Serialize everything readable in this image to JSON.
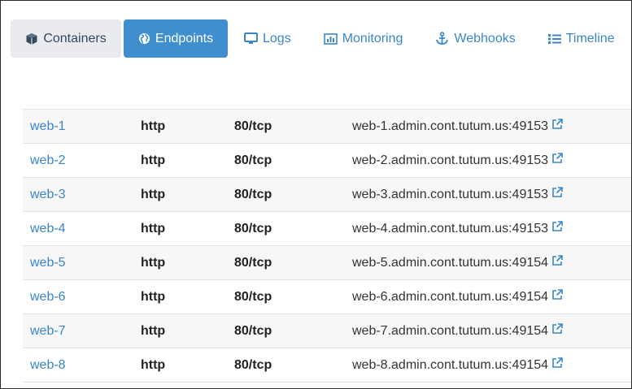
{
  "tabs": [
    {
      "label": "Containers",
      "icon": "cube-icon"
    },
    {
      "label": "Endpoints",
      "icon": "globe-icon"
    },
    {
      "label": "Logs",
      "icon": "monitor-icon"
    },
    {
      "label": "Monitoring",
      "icon": "bar-chart-icon"
    },
    {
      "label": "Webhooks",
      "icon": "anchor-icon"
    },
    {
      "label": "Timeline",
      "icon": "list-icon"
    }
  ],
  "endpoints": [
    {
      "name": "web-1",
      "protocol": "http",
      "port": "80/tcp",
      "url": "web-1.admin.cont.tutum.us:49153"
    },
    {
      "name": "web-2",
      "protocol": "http",
      "port": "80/tcp",
      "url": "web-2.admin.cont.tutum.us:49153"
    },
    {
      "name": "web-3",
      "protocol": "http",
      "port": "80/tcp",
      "url": "web-3.admin.cont.tutum.us:49153"
    },
    {
      "name": "web-4",
      "protocol": "http",
      "port": "80/tcp",
      "url": "web-4.admin.cont.tutum.us:49153"
    },
    {
      "name": "web-5",
      "protocol": "http",
      "port": "80/tcp",
      "url": "web-5.admin.cont.tutum.us:49154"
    },
    {
      "name": "web-6",
      "protocol": "http",
      "port": "80/tcp",
      "url": "web-6.admin.cont.tutum.us:49154"
    },
    {
      "name": "web-7",
      "protocol": "http",
      "port": "80/tcp",
      "url": "web-7.admin.cont.tutum.us:49154"
    },
    {
      "name": "web-8",
      "protocol": "http",
      "port": "80/tcp",
      "url": "web-8.admin.cont.tutum.us:49154"
    }
  ],
  "colors": {
    "link": "#3a86c8",
    "active_tab": "#3e8ed0",
    "inactive_tab_bg": "#e9ebee"
  }
}
